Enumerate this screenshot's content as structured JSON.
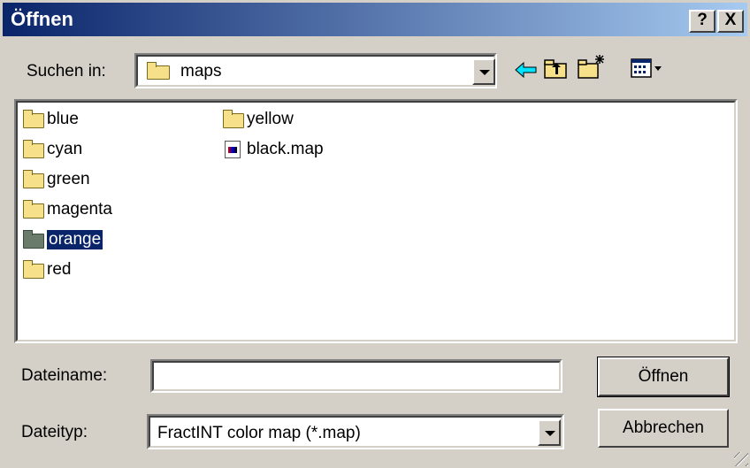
{
  "window": {
    "title": "Öffnen",
    "help_label": "?",
    "close_label": "X"
  },
  "lookin": {
    "label": "Suchen in:",
    "value": "maps"
  },
  "toolbar": {
    "back_icon": "back-arrow-icon",
    "up_icon": "up-folder-icon",
    "new_icon": "new-folder-icon",
    "view_icon": "view-menu-icon"
  },
  "files": {
    "items": [
      {
        "name": "blue",
        "type": "folder"
      },
      {
        "name": "cyan",
        "type": "folder"
      },
      {
        "name": "green",
        "type": "folder"
      },
      {
        "name": "magenta",
        "type": "folder"
      },
      {
        "name": "orange",
        "type": "folder",
        "selected": true
      },
      {
        "name": "red",
        "type": "folder"
      },
      {
        "name": "yellow",
        "type": "folder"
      },
      {
        "name": "black.map",
        "type": "file"
      }
    ]
  },
  "filename": {
    "label": "Dateiname:",
    "value": ""
  },
  "filetype": {
    "label": "Dateityp:",
    "value": "FractINT color map (*.map)"
  },
  "buttons": {
    "open": "Öffnen",
    "cancel": "Abbrechen"
  },
  "colors": {
    "title_start": "#0a246a",
    "title_end": "#a6caf0",
    "selection": "#0a246a",
    "face": "#d4d0c8"
  }
}
